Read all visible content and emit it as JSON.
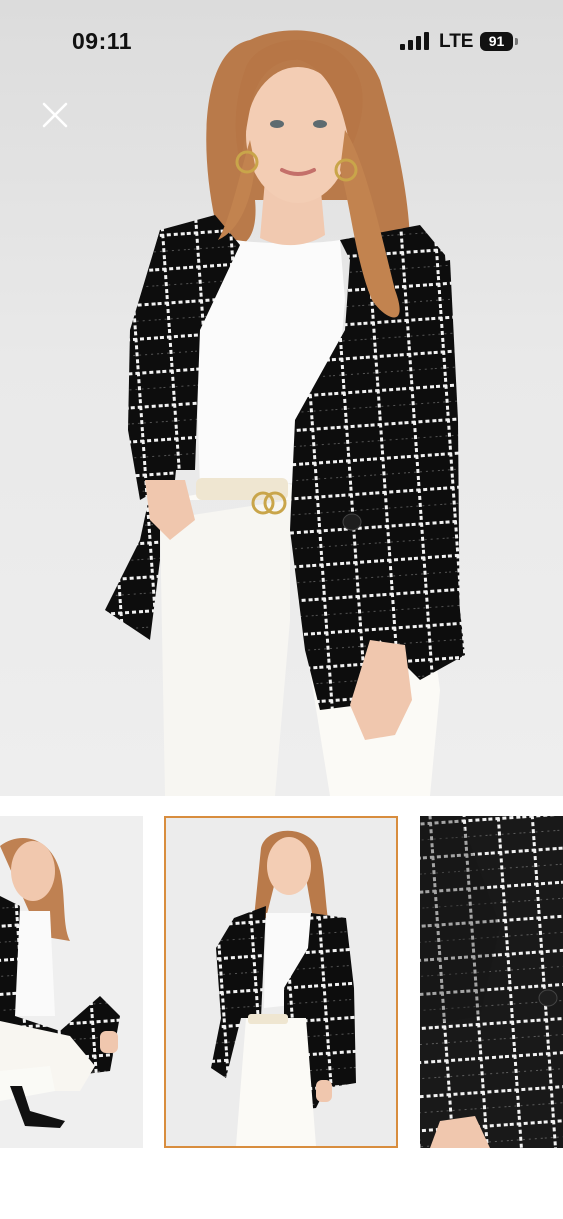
{
  "status_bar": {
    "time": "09:11",
    "network": "LTE",
    "battery": "91"
  },
  "icons": {
    "close": "close-icon",
    "signal": "signal-bars-icon"
  },
  "colors": {
    "selected_thumbnail_border": "#d88d3e",
    "background": "#ffffff",
    "photo_background": "#ececec"
  },
  "gallery": {
    "image_count": 3,
    "selected_index": 1
  }
}
